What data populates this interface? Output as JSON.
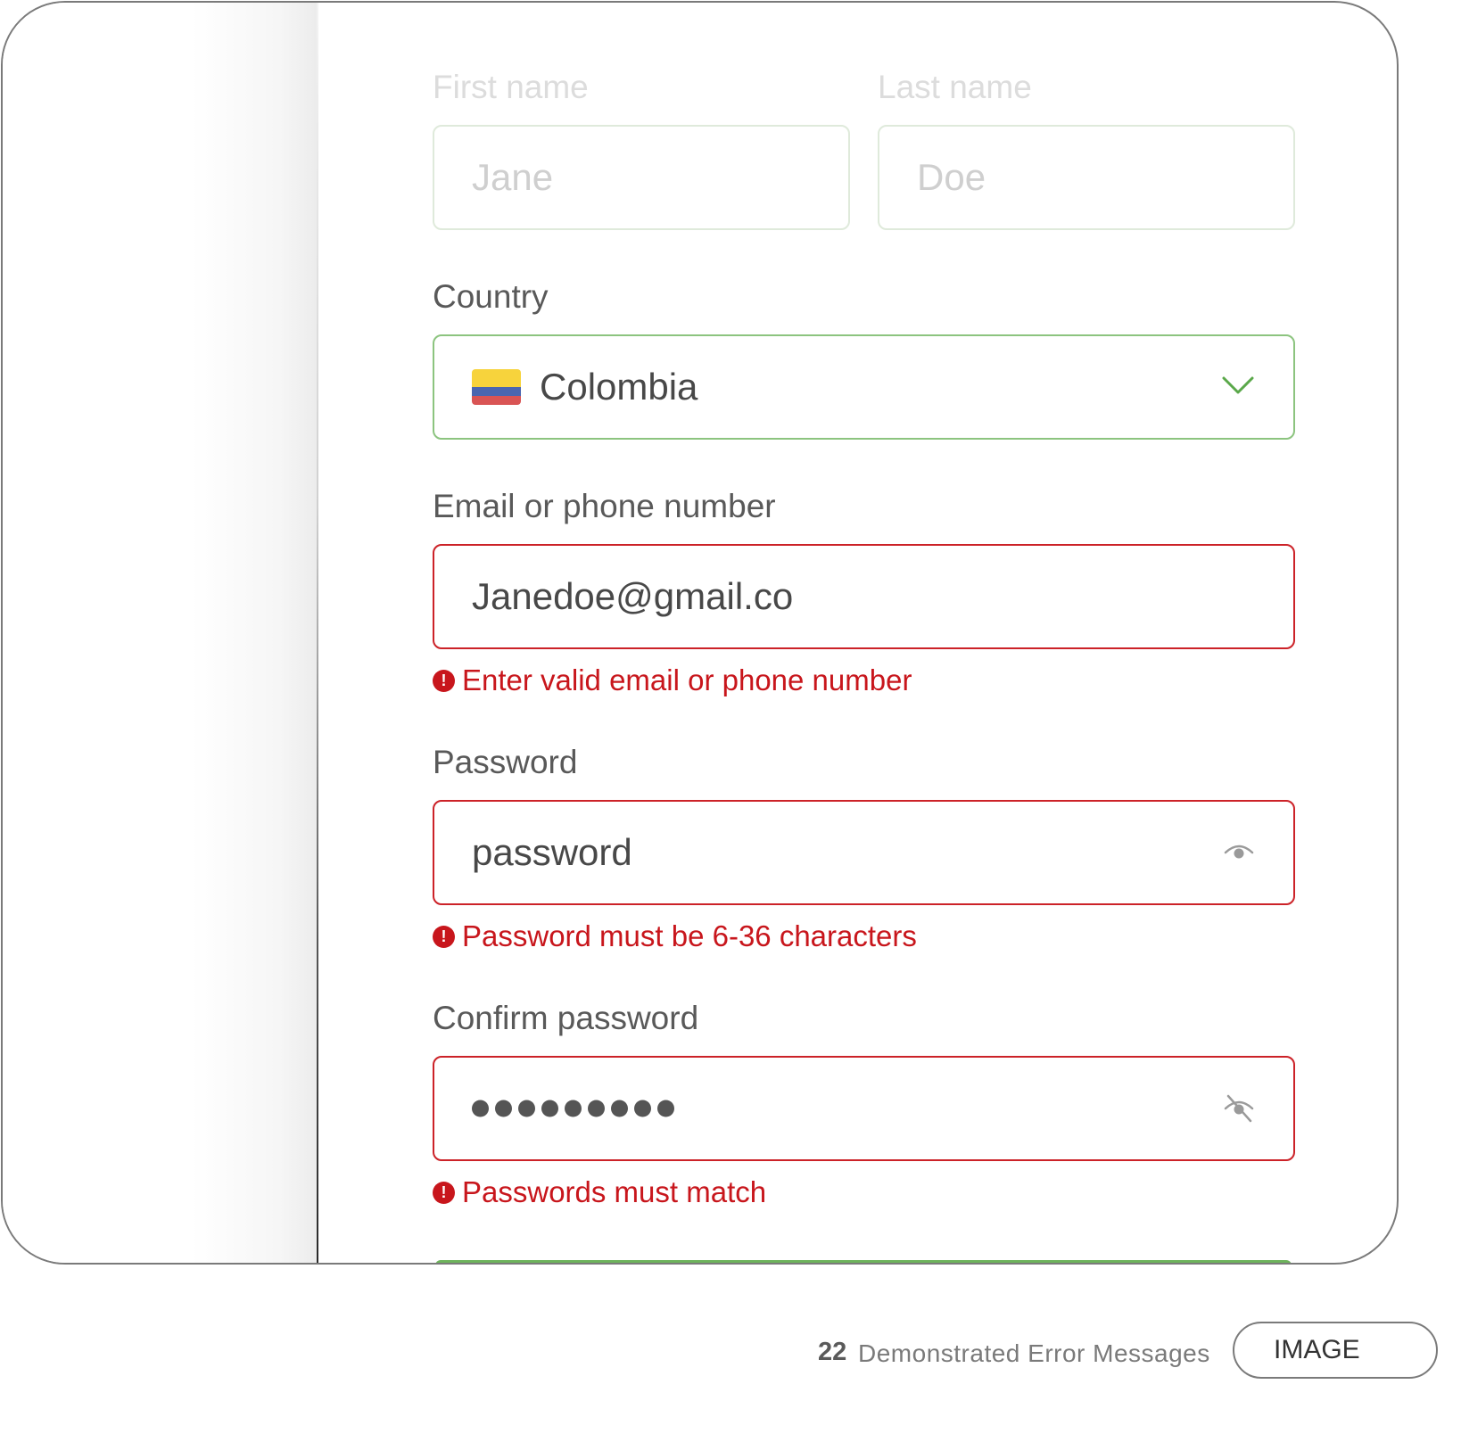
{
  "form": {
    "first_name": {
      "label": "First name",
      "value": "Jane"
    },
    "last_name": {
      "label": "Last name",
      "value": "Doe"
    },
    "country": {
      "label": "Country",
      "value": "Colombia",
      "flag": "colombia-flag"
    },
    "email": {
      "label": "Email or phone number",
      "value": "Janedoe@gmail.co",
      "error": "Enter valid email or phone number"
    },
    "password": {
      "label": "Password",
      "value": "password",
      "error": "Password must be 6-36 characters",
      "toggle_icon": "eye-icon"
    },
    "confirm_password": {
      "label": "Confirm password",
      "masked_length": 9,
      "error": "Passwords must match",
      "toggle_icon": "eye-off-icon"
    }
  },
  "colors": {
    "error": "#c8161c",
    "valid_border": "#8cc47f",
    "error_border": "#cc2228"
  },
  "caption": {
    "number": "22",
    "text": "Demonstrated Error Messages",
    "tag": "IMAGE"
  }
}
